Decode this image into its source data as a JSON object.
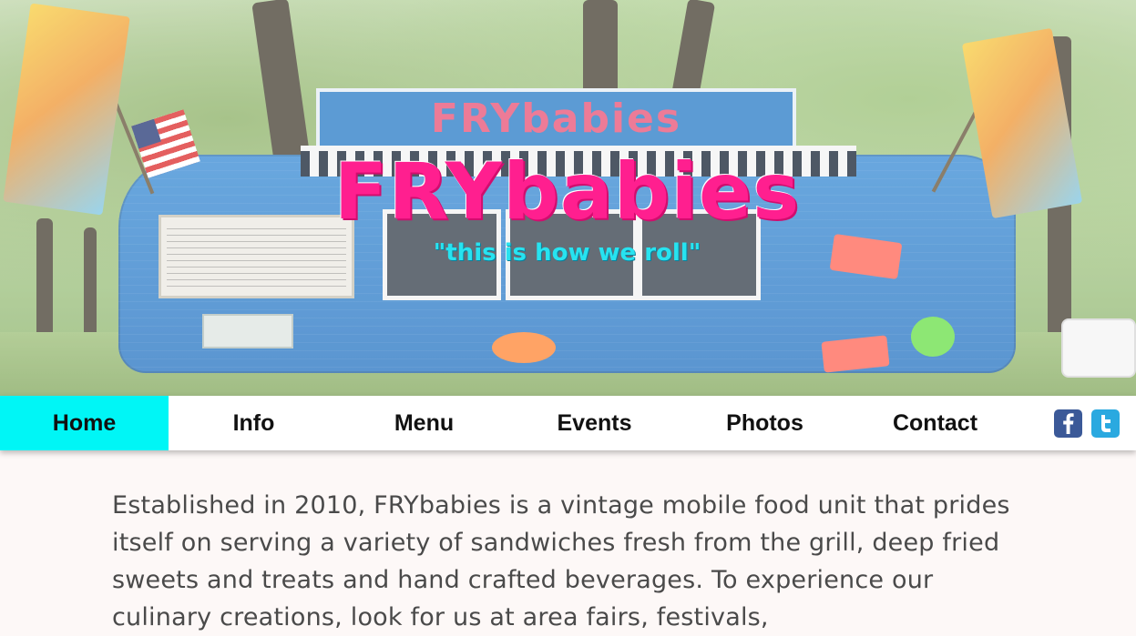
{
  "hero": {
    "title": "FRYbabies",
    "tagline": "\"this is how we roll\"",
    "sign_text": "FRYbabies"
  },
  "nav": {
    "items": [
      {
        "label": "Home",
        "active": true
      },
      {
        "label": "Info",
        "active": false
      },
      {
        "label": "Menu",
        "active": false
      },
      {
        "label": "Events",
        "active": false
      },
      {
        "label": "Photos",
        "active": false
      },
      {
        "label": "Contact",
        "active": false
      }
    ],
    "social": [
      {
        "icon": "facebook-icon"
      },
      {
        "icon": "twitter-icon"
      }
    ]
  },
  "content": {
    "intro": "Established in 2010, FRYbabies is a vintage mobile food unit that prides itself on serving a variety of sandwiches fresh from the grill, deep fried sweets and treats and hand crafted beverages. To experience our culinary creations, look for us at area fairs, festivals,"
  },
  "colors": {
    "accent": "#00f6f6",
    "title_pink": "#ff1f8f",
    "tagline_cyan": "#27e3f0",
    "facebook": "#3b5998",
    "twitter": "#2aa9e0"
  }
}
